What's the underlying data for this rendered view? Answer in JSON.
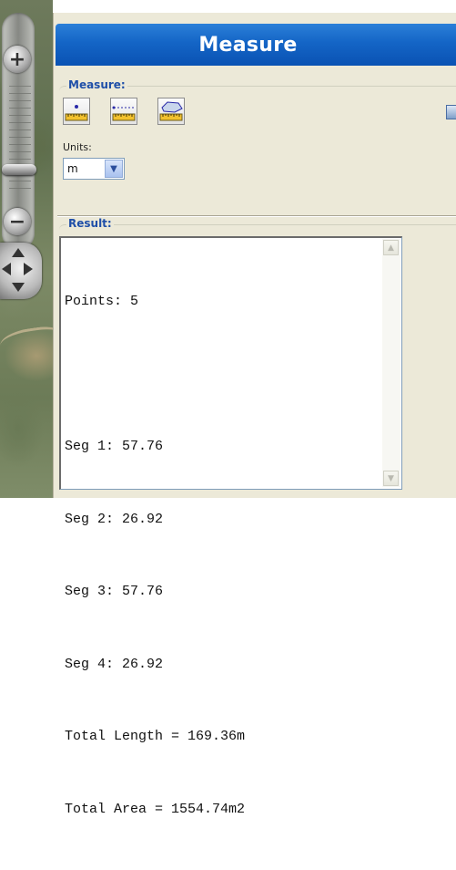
{
  "panel": {
    "title": "Measure"
  },
  "measure": {
    "label": "Measure:",
    "tools": [
      {
        "name": "measure-point",
        "icon": "ruler-point-icon"
      },
      {
        "name": "measure-line",
        "icon": "ruler-line-icon"
      },
      {
        "name": "measure-area",
        "icon": "ruler-area-icon"
      }
    ],
    "units_label": "Units:",
    "units_value": "m"
  },
  "result": {
    "label": "Result:",
    "lines": [
      "Points: 5",
      "",
      "Seg 1: 57.76",
      "Seg 2: 26.92",
      "Seg 3: 57.76",
      "Seg 4: 26.92",
      "Total Length = 169.36m",
      "Total Area = 1554.74m2"
    ]
  },
  "colors": {
    "header_blue": "#1465c6",
    "panel_bg": "#ece9d8",
    "group_label": "#1f4fa8"
  }
}
